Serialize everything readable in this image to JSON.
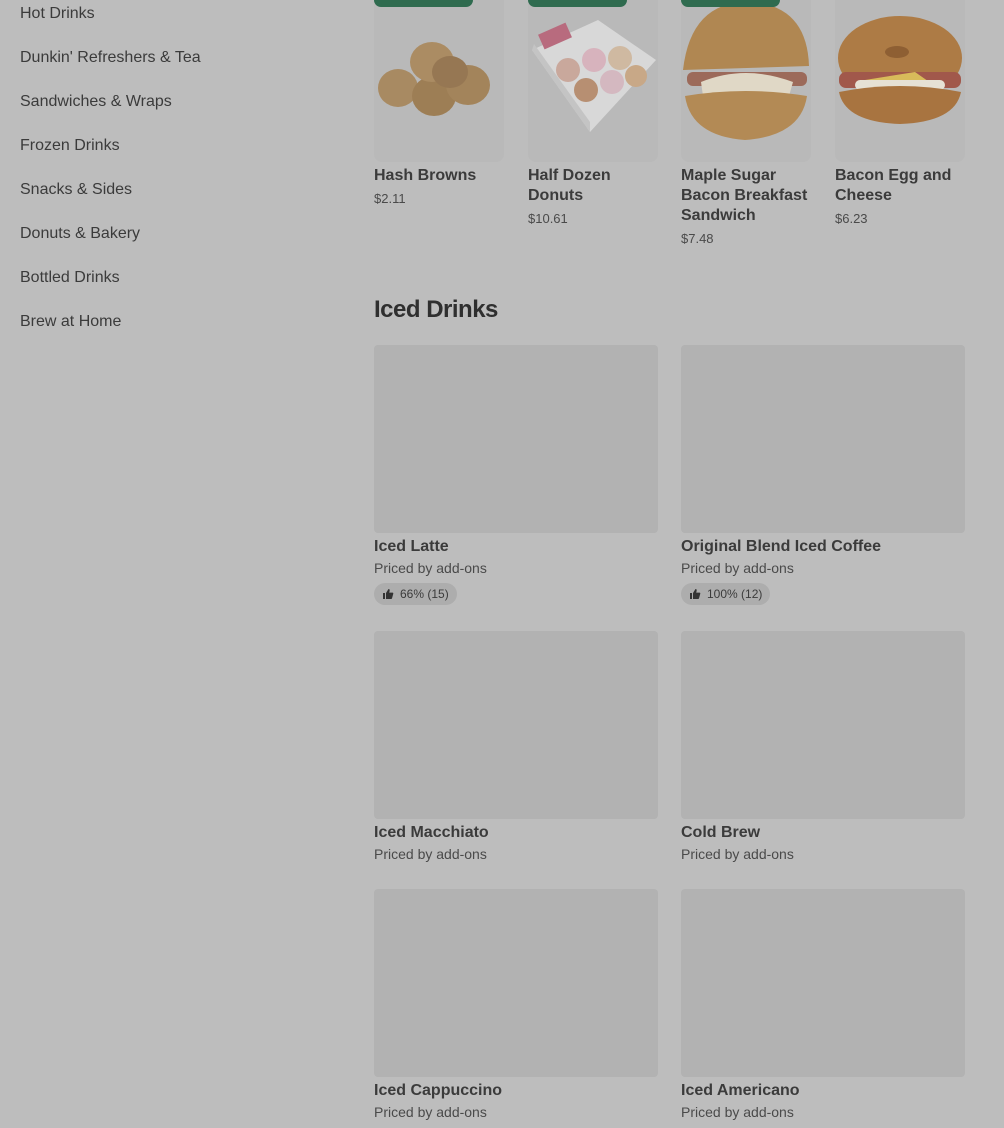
{
  "sidebar": {
    "items": [
      {
        "label": "Hot Drinks"
      },
      {
        "label": "Dunkin' Refreshers & Tea"
      },
      {
        "label": "Sandwiches & Wraps"
      },
      {
        "label": "Frozen Drinks"
      },
      {
        "label": "Snacks & Sides"
      },
      {
        "label": "Donuts & Bakery"
      },
      {
        "label": "Bottled Drinks"
      },
      {
        "label": "Brew at Home"
      }
    ]
  },
  "featured": {
    "items": [
      {
        "name": "Hash Browns",
        "price": "$2.11"
      },
      {
        "name": "Half Dozen Donuts",
        "price": "$10.61"
      },
      {
        "name": "Maple Sugar Bacon Breakfast Sandwich",
        "price": "$7.48"
      },
      {
        "name": "Bacon Egg and Cheese",
        "price": "$6.23"
      }
    ]
  },
  "iced_drinks": {
    "title": "Iced Drinks",
    "items": [
      {
        "name": "Iced Latte",
        "sub": "Priced by add-ons",
        "rating": "66% (15)"
      },
      {
        "name": "Original Blend Iced Coffee",
        "sub": "Priced by add-ons",
        "rating": "100% (12)"
      },
      {
        "name": "Iced Macchiato",
        "sub": "Priced by add-ons"
      },
      {
        "name": "Cold Brew",
        "sub": "Priced by add-ons"
      },
      {
        "name": "Iced Cappuccino",
        "sub": "Priced by add-ons"
      },
      {
        "name": "Iced Americano",
        "sub": "Priced by add-ons"
      }
    ]
  },
  "colors": {
    "overlay_bg": "#bdbdbd",
    "tag_green": "#2f6b4f"
  }
}
